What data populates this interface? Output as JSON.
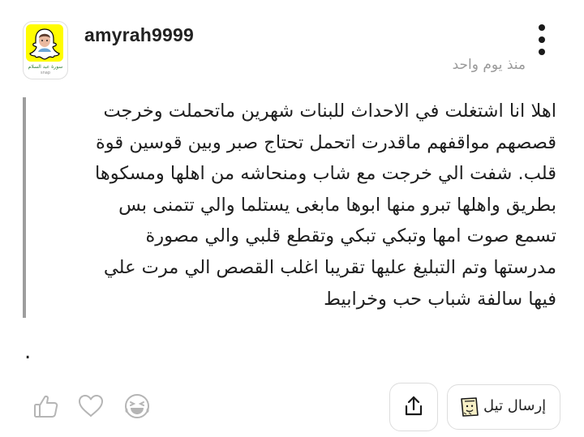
{
  "post": {
    "author": {
      "username": "amyrah9999",
      "avatar_caption": "سورة عبد السلام",
      "avatar_caption_sub": "snap"
    },
    "time_ago": "منذ يوم واحد",
    "body": "اهلا انا اشتغلت في الاحداث للبنات شهرين ماتحملت وخرجت\nقصصهم مواقفهم ماقدرت اتحمل تحتاج صبر وبين قوسين قوة\nقلب. شفت الي خرجت مع شاب ومنحاشه من اهلها ومسكوها\nبطريق واهلها تبرو منها ابوها مابغى يستلما والي تتمنى بس\nتسمع صوت امها وتبكي تبكي   وتقطع قلبي   والي مصورة\nمدرستها وتم التبليغ عليها تقريبا اغلب القصص الي مرت علي\nفيها سالفة شباب حب وخرابيط",
    "trailing_text": "."
  },
  "actions": {
    "reactions": [
      "like-icon",
      "heart-icon",
      "laugh-icon"
    ],
    "share_icon": "share-icon",
    "send_label": "إرسال تيل",
    "send_icon": "teal-card-icon"
  },
  "colors": {
    "accent_yellow": "#fffc00",
    "quote_bar": "#9e9e9e",
    "icon_gray": "#b5b5b5",
    "text": "#1f1f1f",
    "muted": "#9a9a9a"
  }
}
